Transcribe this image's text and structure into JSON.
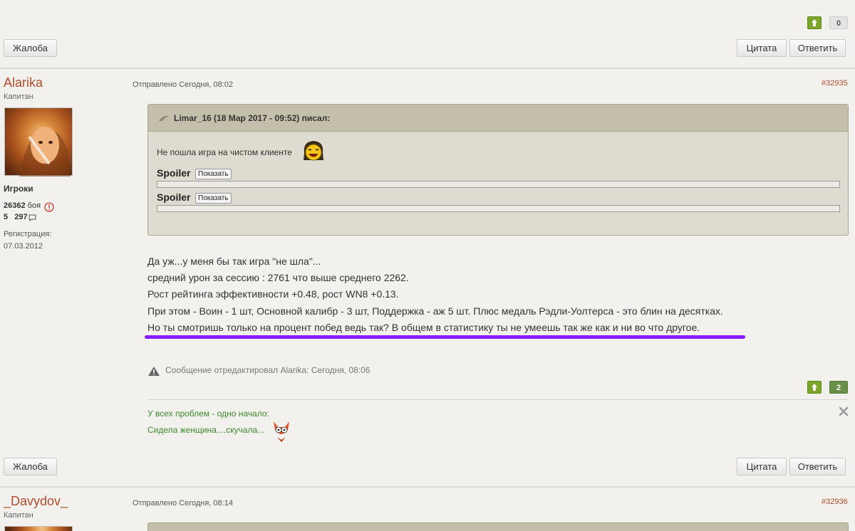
{
  "top_bar": {
    "vote_count": "0",
    "complaint_label": "Жалоба",
    "quote_label": "Цитата",
    "reply_label": "Ответить"
  },
  "post1": {
    "username": "Alarika",
    "rank": "Капитан",
    "group": "Игроки",
    "battles_count": "26362",
    "battles_word": "боя",
    "rating_left": "5",
    "rating_right": "297",
    "reg_label": "Регистрация:",
    "reg_date": "07.03.2012",
    "sent_text": "Отправлено Сегодня, 08:02",
    "permalink": "#32935",
    "quote": {
      "author": "Limar_16 (18 Мар 2017 - 09:52) писал:",
      "text": "Не пошла игра на чистом клиенте",
      "spoilers": [
        {
          "label": "Spoiler",
          "button": "Показать"
        },
        {
          "label": "Spoiler",
          "button": "Показать"
        }
      ]
    },
    "body_lines": [
      "Да уж...у меня бы так игра \"не шла\"...",
      "средний урон за сессию : 2761 что выше среднего 2262.",
      "Рост рейтинга эффективности +0.48, рост WN8 +0.13.",
      "При этом - Воин - 1 шт, Основной калибр - 3 шт, Поддержка - аж 5 шт. Плюс медаль Рэдли-Уолтерса - это блин на десятках.",
      "Но ты смотришь только на процент побед ведь так? В общем в статистику ты не умеешь так же как и ни во что другое."
    ],
    "edited_text": "Сообщение отредактировал Alarika: Сегодня, 08:06",
    "vote_count": "2",
    "signature_lines": [
      "У всех проблем - одно начало:",
      "Сидела женщина....скучала..."
    ],
    "complaint_label": "Жалоба",
    "quote_label": "Цитата",
    "reply_label": "Ответить"
  },
  "post2": {
    "username": "_Davydov_",
    "rank": "Капитан",
    "sent_text": "Отправлено Сегодня, 08:14",
    "permalink": "#32936"
  },
  "colors": {
    "username": "#b04c2a",
    "vote_up": "#7ca62a",
    "signature": "#3a8a2a",
    "underline": "#8a1aff"
  }
}
